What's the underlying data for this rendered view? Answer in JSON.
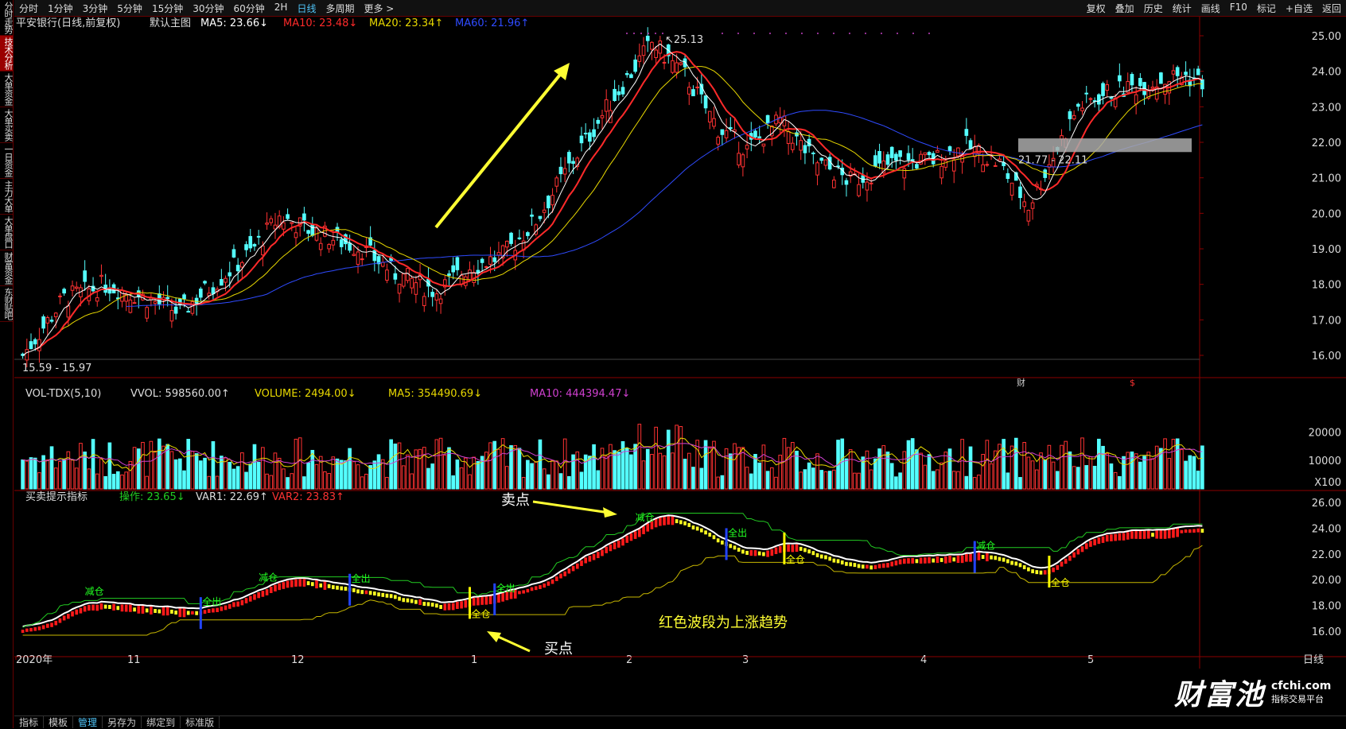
{
  "leftbar": [
    "分时走势",
    "技术分析",
    "大单资金",
    "大单买卖",
    "一日资金",
    "主力大单",
    "大单盘口",
    "财富资金",
    "东财贴吧"
  ],
  "periods": [
    "分时",
    "1分钟",
    "3分钟",
    "5分钟",
    "15分钟",
    "30分钟",
    "60分钟",
    "2H",
    "日线",
    "多周期",
    "更多 >"
  ],
  "tools": [
    "复权",
    "叠加",
    "历史",
    "统计",
    "画线",
    "F10",
    "标记",
    "+自选",
    "返回"
  ],
  "main_legend": {
    "title": "平安银行(日线,前复权)",
    "template": "默认主图",
    "ma5": "MA5: 23.66↓",
    "ma10": "MA10: 23.48↓",
    "ma20": "MA20: 23.34↑",
    "ma60": "MA60: 21.96↑",
    "colors": {
      "ma5": "#ffffff",
      "ma10": "#ff2a2a",
      "ma20": "#e8d800",
      "ma60": "#2f4bff"
    }
  },
  "vol_legend": {
    "name": "VOL-TDX(5,10)",
    "vvol": "VVOL: 598560.00↑",
    "volume": "VOLUME: 2494.00↓",
    "ma5": "MA5: 354490.69↓",
    "ma10": "MA10: 444394.47↓"
  },
  "ind_legend": {
    "name": "买卖提示指标",
    "op": "操作: 23.65↓",
    "var1": "VAR1: 22.69↑",
    "var2": "VAR2: 23.83↑"
  },
  "annotations": {
    "high": "25.13",
    "low": "15.59",
    "low2": "15.97",
    "zone": "21.77 - 22.11",
    "sell": "卖点",
    "buy": "买点",
    "note": "红色波段为上涨趋势",
    "cai": "财",
    "dollar": "$"
  },
  "signals": {
    "reduce": "减仓",
    "allout": "全出",
    "allin": "全仓"
  },
  "watermark": {
    "big": "财富池",
    "url": "cfchi.com",
    "sub": "指标交易平台"
  },
  "bottom_tabs": [
    "指标",
    "模板",
    "管理",
    "另存为",
    "绑定到",
    "标准版"
  ],
  "period_label": "日线",
  "chart_data": [
    {
      "type": "candlestick",
      "title": "平安银行(日线,前复权)",
      "ylim": [
        15.5,
        25.3
      ],
      "y_ticks": [
        "25.00",
        "24.00",
        "23.00",
        "22.00",
        "21.00",
        "20.00",
        "19.00",
        "18.00",
        "17.00",
        "16.00"
      ],
      "x_ticks": [
        "2020年",
        "11",
        "12",
        "1",
        "2",
        "3",
        "4",
        "5"
      ],
      "series": [
        {
          "name": "MA5",
          "last": 23.66
        },
        {
          "name": "MA10",
          "last": 23.48
        },
        {
          "name": "MA20",
          "last": 23.34
        },
        {
          "name": "MA60",
          "last": 21.96
        }
      ],
      "high": 25.13,
      "low": 15.59
    },
    {
      "type": "bar",
      "title": "VOL-TDX(5,10)",
      "y_ticks": [
        "20000",
        "10000",
        "X100"
      ]
    },
    {
      "type": "line",
      "title": "买卖提示指标",
      "y_ticks": [
        "26.00",
        "24.00",
        "22.00",
        "20.00",
        "18.00",
        "16.00"
      ]
    }
  ]
}
